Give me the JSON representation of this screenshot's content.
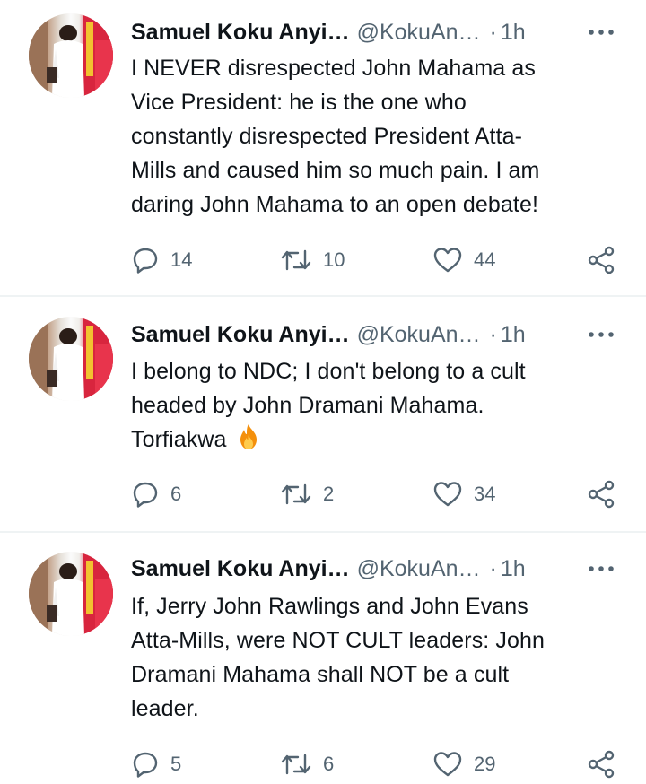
{
  "tweets": [
    {
      "author": {
        "name": "Samuel Koku Anyi…",
        "handle": "@KokuAn…",
        "separator": "·",
        "time": "1h"
      },
      "text": "I NEVER disrespected John Mahama as\nVice President: he is the one who\nconstantly disrespected President Atta-\nMills and caused him so much pain. I am\ndaring John Mahama to an open debate!",
      "reply_count": "14",
      "retweet_count": "10",
      "like_count": "44"
    },
    {
      "author": {
        "name": "Samuel Koku Anyi…",
        "handle": "@KokuAn…",
        "separator": "·",
        "time": "1h"
      },
      "text": "I belong to NDC; I don't belong to a cult\nheaded by John Dramani Mahama.\nTorfiakwa",
      "emoji": "fire-emoji",
      "reply_count": "6",
      "retweet_count": "2",
      "like_count": "34"
    },
    {
      "author": {
        "name": "Samuel Koku Anyi…",
        "handle": "@KokuAn…",
        "separator": "·",
        "time": "1h"
      },
      "text": "If, Jerry John Rawlings and John Evans\nAtta-Mills, were NOT CULT leaders: John\nDramani Mahama shall NOT be a cult\nleader.",
      "reply_count": "5",
      "retweet_count": "6",
      "like_count": "29"
    }
  ],
  "icons": {
    "reply": "reply-icon",
    "retweet": "retweet-icon",
    "like": "heart-icon",
    "share": "share-icon",
    "more": "more-options-icon"
  },
  "colors": {
    "text_primary": "#0f1419",
    "text_secondary": "#536471",
    "divider": "#eff3f4"
  }
}
